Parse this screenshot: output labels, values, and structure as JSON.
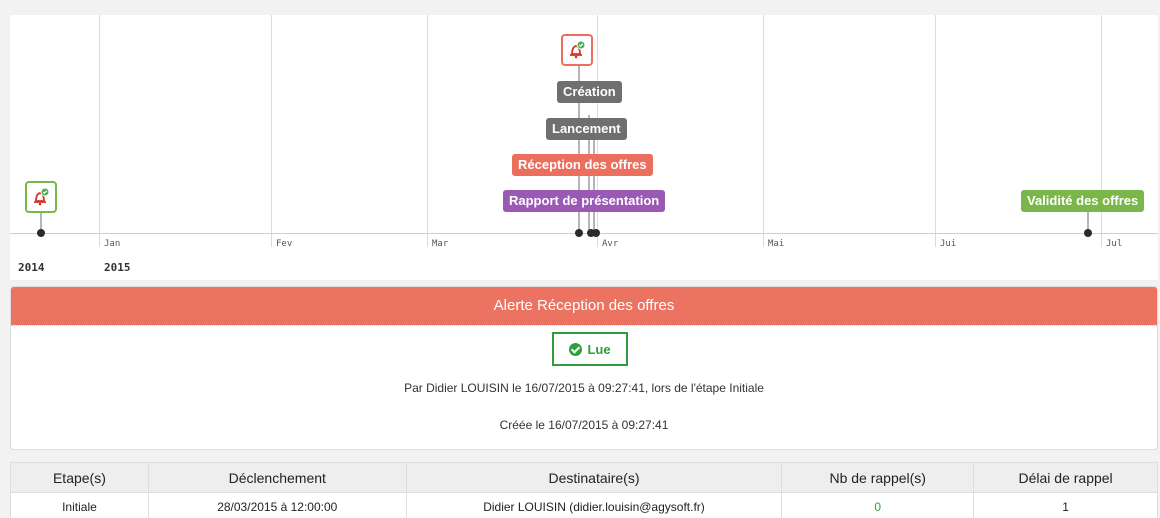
{
  "timeline": {
    "months": [
      "Jan",
      "Fev",
      "Mar",
      "Avr",
      "Mai",
      "Jui",
      "Jul"
    ],
    "years": [
      "2014",
      "2015"
    ],
    "events": [
      {
        "label": "Création",
        "color": "#6f6f6f"
      },
      {
        "label": "Lancement",
        "color": "#6f6f6f"
      },
      {
        "label": "Réception des offres",
        "color": "#ec6f5d"
      },
      {
        "label": "Rapport de présentation",
        "color": "#9b59b6"
      },
      {
        "label": "Validité des offres",
        "color": "#7ab648"
      }
    ],
    "alert_icons": [
      {
        "icon": "bell-check-icon",
        "status_color": "#7ab648"
      },
      {
        "icon": "bell-check-icon",
        "status_color": "#ec6f5d"
      }
    ]
  },
  "alert": {
    "title": "Alerte Réception des offres",
    "status": "Lue",
    "status_icon": "check-circle-icon",
    "read_by": "Par Didier LOUISIN le 16/07/2015 à 09:27:41, lors de l'étape Initiale",
    "created": "Créée le 16/07/2015 à 09:27:41",
    "header_color": "#ec7261"
  },
  "table": {
    "headers": [
      "Etape(s)",
      "Déclenchement",
      "Destinataire(s)",
      "Nb de rappel(s)",
      "Délai de rappel"
    ],
    "rows": [
      [
        "Initiale",
        "28/03/2015 à 12:00:00",
        "Didier LOUISIN (didier.louisin@agysoft.fr)",
        "0",
        "1"
      ]
    ]
  }
}
